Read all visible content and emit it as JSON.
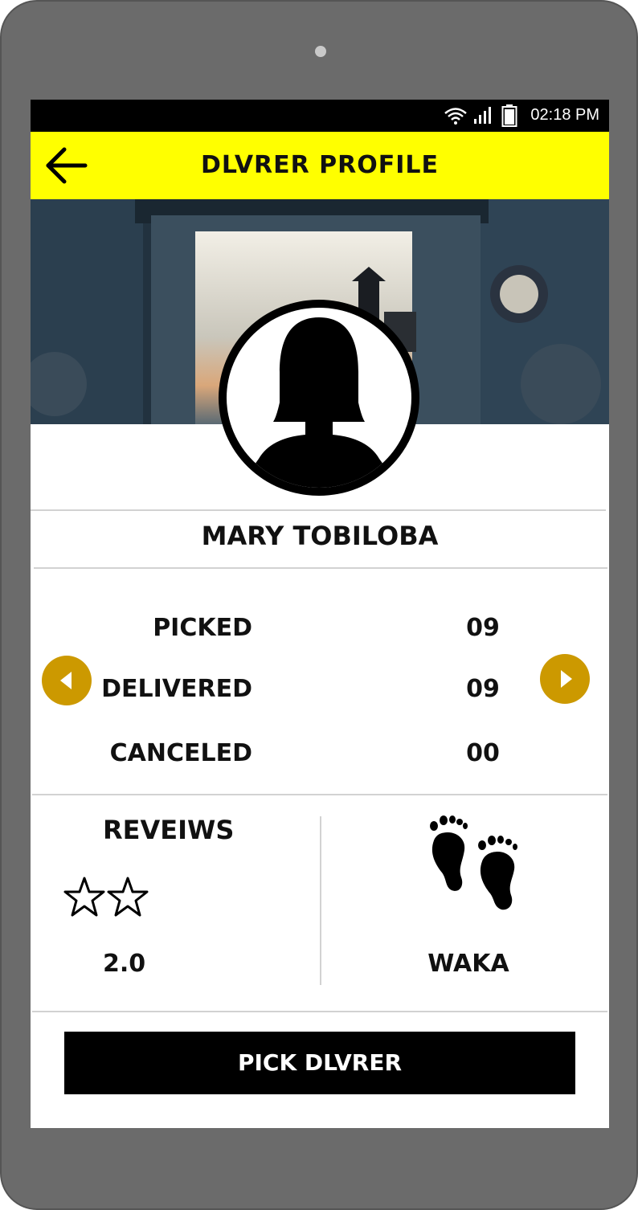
{
  "status_bar": {
    "time": "02:18 PM",
    "icons": [
      "wifi-icon",
      "signal-icon",
      "battery-icon"
    ]
  },
  "app_bar": {
    "title": "DLVRER PROFILE",
    "back_icon": "arrow-left-icon"
  },
  "profile": {
    "name": "MARY TOBILOBA",
    "avatar_icon": "female-user-silhouette-icon"
  },
  "stats": [
    {
      "label": "PICKED",
      "value": "09"
    },
    {
      "label": "DELIVERED",
      "value": "09"
    },
    {
      "label": "CANCELED",
      "value": "00"
    }
  ],
  "reviews": {
    "title": "REVEIWS",
    "rating": "2.0",
    "stars_shown": 2,
    "star_style": "outline"
  },
  "company": {
    "name": "WAKA",
    "icon": "footprints-icon"
  },
  "actions": {
    "pick_label": "PICK DLVRER"
  },
  "colors": {
    "app_bar": "#ffff00",
    "arrow_buttons": "#cc9900",
    "primary_button": "#000000",
    "device_frame": "#6b6b6b"
  }
}
